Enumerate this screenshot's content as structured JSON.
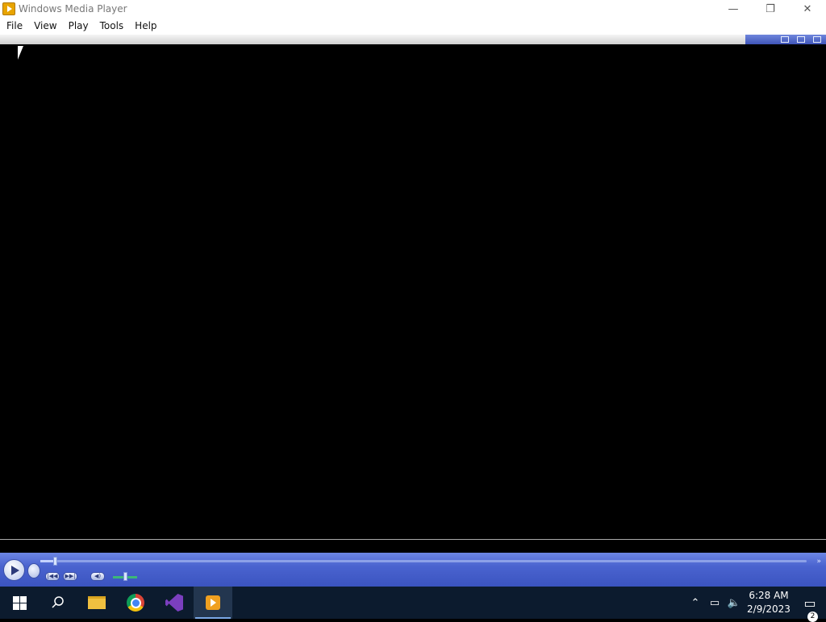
{
  "window": {
    "title": "Windows Media Player",
    "controls": {
      "minimize": "—",
      "restore": "❐",
      "close": "✕"
    }
  },
  "menu": {
    "items": [
      "File",
      "View",
      "Play",
      "Tools",
      "Help"
    ]
  },
  "player": {
    "seek_progress": 0.02,
    "volume_level": 0.5,
    "buttons": {
      "prev_label": "|◀◀",
      "next_label": "▶▶|",
      "mute_label": "◀)"
    },
    "expand_label": "»"
  },
  "taskbar": {
    "clock_time": "6:28 AM",
    "clock_date": "2/9/2023",
    "notification_count": "2",
    "tray_icons": [
      "chevron-up-icon",
      "network-icon",
      "volume-icon"
    ]
  },
  "colors": {
    "controls_accent": "#4a63cf",
    "taskbar_bg": "#0c1b2e",
    "volume_fill": "#3cb878"
  }
}
